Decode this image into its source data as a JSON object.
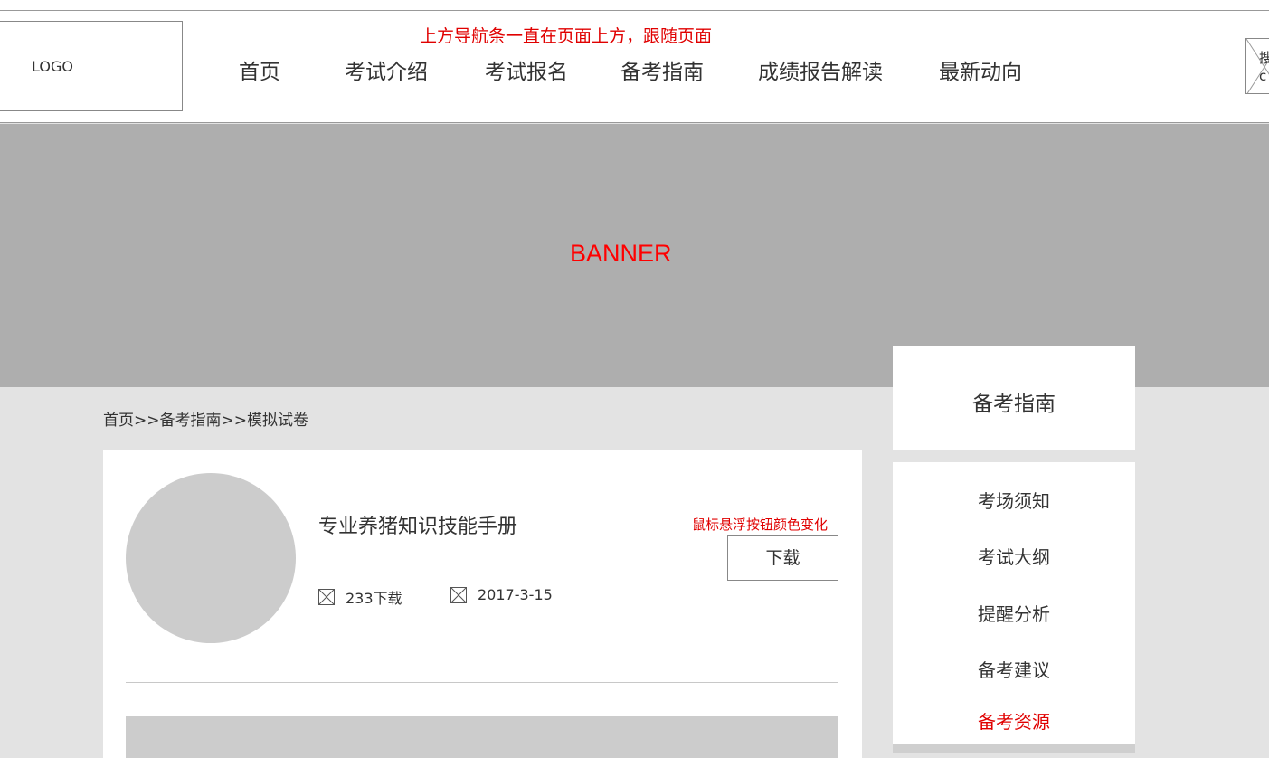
{
  "header": {
    "logo_text": "LOGO",
    "note": "上方导航条一直在页面上方，跟随页面",
    "nav": [
      {
        "label": "首页"
      },
      {
        "label": "考试介绍"
      },
      {
        "label": "考试报名"
      },
      {
        "label": "备考指南"
      },
      {
        "label": "成绩报告解读"
      },
      {
        "label": "最新动向"
      }
    ],
    "search_label": "搜ic"
  },
  "banner": {
    "text": "BANNER"
  },
  "breadcrumb": "首页>>备考指南>>模拟试卷",
  "resource": {
    "title": "专业养猪知识技能手册",
    "downloads": "233下载",
    "date": "2017-3-15",
    "hover_note": "鼠标悬浮按钮颜色变化",
    "download_label": "下载"
  },
  "sidebar": {
    "heading": "备考指南",
    "items": [
      {
        "label": "考场须知"
      },
      {
        "label": "考试大纲"
      },
      {
        "label": "提醒分析"
      },
      {
        "label": "备考建议"
      },
      {
        "label": "备考资源",
        "active": true
      }
    ]
  },
  "colors": {
    "accent_red": "#e00000",
    "banner_gray": "#aeaeae",
    "page_bg": "#e3e3e3"
  }
}
